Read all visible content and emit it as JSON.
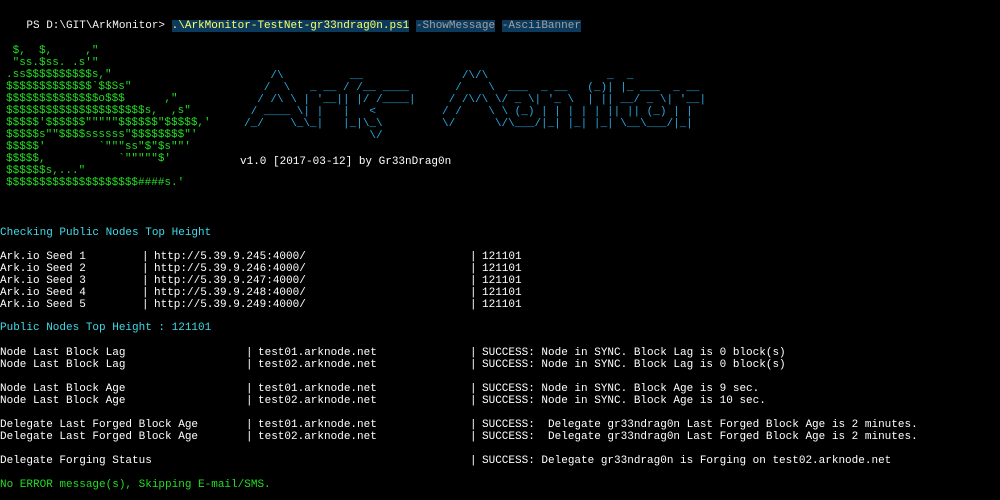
{
  "prompt": {
    "path": "PS D:\\GIT\\ArkMonitor> ",
    "script": ".\\ArkMonitor-TestNet-gr33ndrag0n.ps1",
    "arg1": "-ShowMessage",
    "arg2": "-AsciiBanner"
  },
  "banner": {
    "logo": " $,  $,     ,\"\n \"ss.$ss. .s'\"\n.ss$$$$$$$$$$s,\"\n$$$$$$$$$$$$$`$$Ss\"\n$$$$$$$$$$$$$$o$$$      ,\"\n$$$$$$$$$$$$$$$$$$$$$s,  ,s\"\n$$$$$'$$$$$$\"\"\"\"\"$$$$$$\"$$$$$,'\n$$$$$s\"\"$$$$ssssss\"$$$$$$$$\"'\n$$$$$'        `\"\"\"ss\"$\"$s\"\"'\n$$$$$,           `\"\"\"\"\"$'\n$$$$$$s,...\"\n$$$$$$$$$$$$$$$$$$$$####s.'",
    "title_art": "    /\\          __               /\\/\\                  _  _\n   /  \\   _ __ / /__ ____       /    \\  ___  _ __   (_)| |_ ___  _ __\n  / /\\ \\ | '__|| |/ /____|     / /\\/\\ \\/ _ \\| '_ \\  | || __/ _ \\| '__|\n / ____ \\| |   |   <          / /    \\ \\ (_) | | | | | || || (_) | |\n/_/    \\_\\_|   |_|\\_\\         \\/      \\/\\___/|_| |_| |_| \\__\\___/|_|\n                   \\/",
    "version": "v1.0 [2017-03-12] by Gr33nDrag0n"
  },
  "checking": {
    "heading": "Checking Public Nodes Top Height",
    "seeds": [
      {
        "name": "Ark.io Seed 1",
        "url": "http://5.39.9.245:4000/",
        "height": "121101"
      },
      {
        "name": "Ark.io Seed 2",
        "url": "http://5.39.9.246:4000/",
        "height": "121101"
      },
      {
        "name": "Ark.io Seed 3",
        "url": "http://5.39.9.247:4000/",
        "height": "121101"
      },
      {
        "name": "Ark.io Seed 4",
        "url": "http://5.39.9.248:4000/",
        "height": "121101"
      },
      {
        "name": "Ark.io Seed 5",
        "url": "http://5.39.9.249:4000/",
        "height": "121101"
      }
    ],
    "summary": "Public Nodes Top Height : 121101"
  },
  "checks": [
    {
      "label": "Node Last Block Lag",
      "node": "test01.arknode.net",
      "result": "SUCCESS: Node in SYNC. Block Lag is 0 block(s)"
    },
    {
      "label": "Node Last Block Lag",
      "node": "test02.arknode.net",
      "result": "SUCCESS: Node in SYNC. Block Lag is 0 block(s)"
    },
    {
      "label": "Node Last Block Age",
      "node": "test01.arknode.net",
      "result": "SUCCESS: Node in SYNC. Block Age is 9 sec."
    },
    {
      "label": "Node Last Block Age",
      "node": "test02.arknode.net",
      "result": "SUCCESS: Node in SYNC. Block Age is 10 sec."
    },
    {
      "label": "Delegate Last Forged Block Age",
      "node": "test01.arknode.net",
      "result": "SUCCESS:  Delegate gr33ndrag0n Last Forged Block Age is 2 minutes."
    },
    {
      "label": "Delegate Last Forged Block Age",
      "node": "test02.arknode.net",
      "result": "SUCCESS:  Delegate gr33ndrag0n Last Forged Block Age is 2 minutes."
    },
    {
      "label": "Delegate Forging Status",
      "node": "",
      "result": "SUCCESS: Delegate gr33ndrag0n is Forging on test02.arknode.net"
    }
  ],
  "footer": {
    "message": "No ERROR message(s), Skipping E-mail/SMS."
  },
  "colors": {
    "background": "#000000",
    "text": "#ffffff",
    "heading": "#3fd9e8",
    "logo": "#22dd22",
    "title_art": "#2aa8e0",
    "script_highlight": "#ffff66",
    "selection_bg": "#0b3a5c"
  }
}
